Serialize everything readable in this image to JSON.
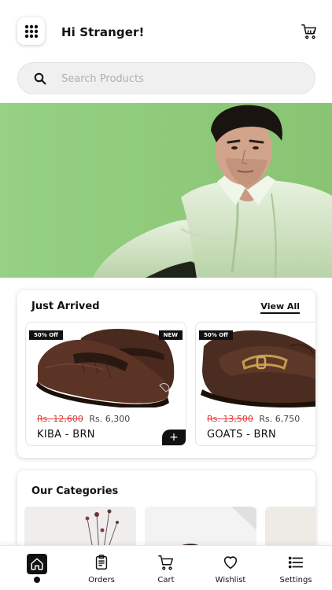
{
  "header": {
    "greeting": "Hi Stranger!",
    "menu_icon": "grid-dots-icon",
    "cart_icon": "cart-icon"
  },
  "search": {
    "placeholder": "Search Products",
    "value": "",
    "icon": "search-icon"
  },
  "hero": {
    "icon": "hero-banner-image",
    "bg_color": "#8fcc7a"
  },
  "just_arrived": {
    "title": "Just Arrived",
    "view_all": "View All",
    "products": [
      {
        "name": "KIBA - BRN",
        "discount_badge": "50% Off",
        "new_badge": "NEW",
        "old_price": "Rs. 12,600",
        "price": "Rs. 6,300",
        "add_label": "+"
      },
      {
        "name": "GOATS - BRN",
        "discount_badge": "50% Off",
        "old_price": "Rs. 13,500",
        "price": "Rs. 6,750"
      }
    ]
  },
  "categories": {
    "title": "Our Categories"
  },
  "nav": {
    "items": [
      {
        "label": "",
        "icon": "home-icon",
        "active": true
      },
      {
        "label": "Orders",
        "icon": "orders-icon"
      },
      {
        "label": "Cart",
        "icon": "cart-icon"
      },
      {
        "label": "Wishlist",
        "icon": "heart-icon"
      },
      {
        "label": "Settings",
        "icon": "settings-list-icon"
      }
    ]
  },
  "colors": {
    "accent": "#111111",
    "sale_red": "#e53935",
    "hero_green": "#8fcc7a"
  }
}
